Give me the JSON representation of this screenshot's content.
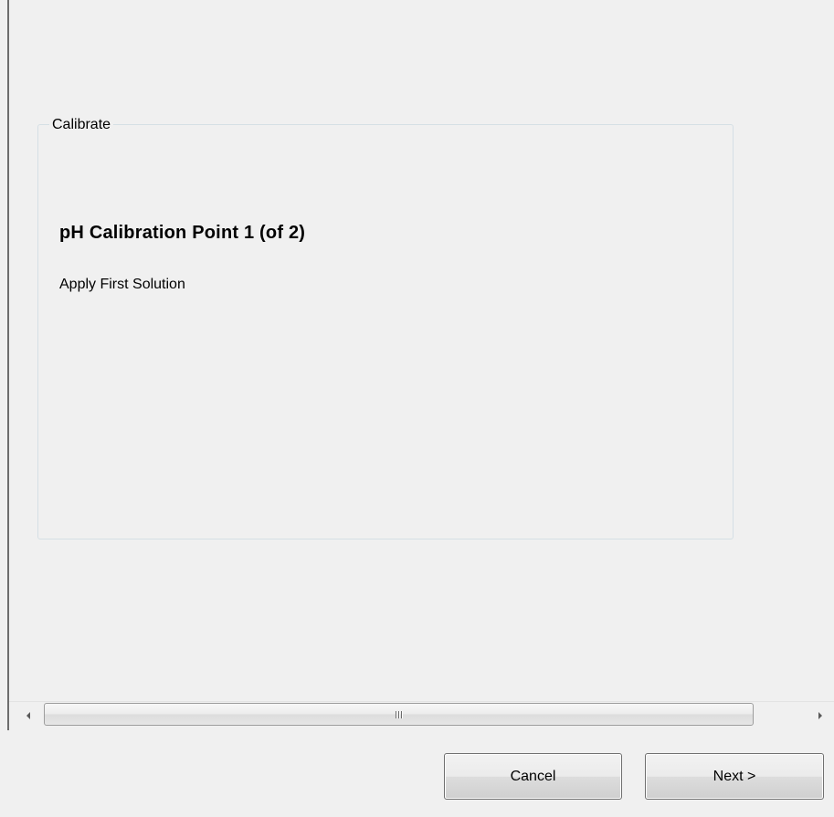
{
  "calibrate_group": {
    "legend": "Calibrate",
    "step_title": "pH Calibration Point 1 (of 2)",
    "instruction": "Apply First Solution"
  },
  "scrollbar": {
    "grip": "III"
  },
  "footer": {
    "cancel_label": "Cancel",
    "next_label": "Next >"
  }
}
